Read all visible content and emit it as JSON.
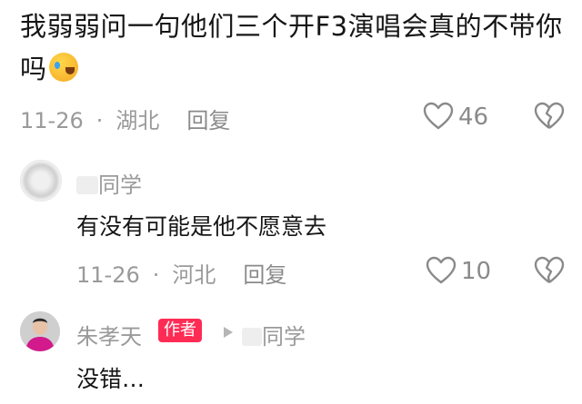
{
  "comment": {
    "text": "我弱弱问一句他们三个开F3演唱会真的不带你吗",
    "emoji": "laughing-tears-emoji",
    "date": "11-26",
    "location": "湖北",
    "reply_label": "回复",
    "like_count": "46"
  },
  "reply1": {
    "username": "同学",
    "text": "有没有可能是他不愿意去",
    "date": "11-26",
    "location": "河北",
    "reply_label": "回复",
    "like_count": "10"
  },
  "reply2": {
    "username": "朱孝天",
    "author_badge": "作者",
    "reply_to": "同学",
    "text": "没错…"
  },
  "colors": {
    "accent": "#fe2c55",
    "muted": "#9a9a9a",
    "text": "#161616"
  }
}
